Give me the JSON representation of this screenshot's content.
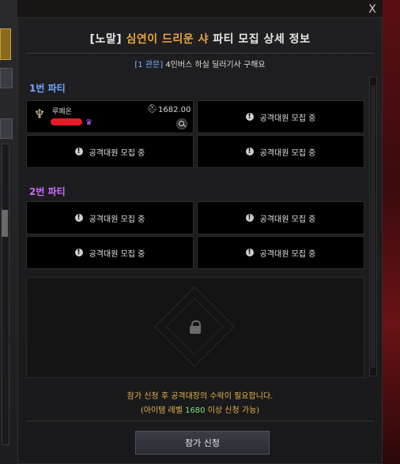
{
  "window": {
    "close_label": "X"
  },
  "header": {
    "prefix": "[노말]",
    "raid_name": "심연이 드리운 샤",
    "suffix": "파티 모집 상세 정보",
    "sub_region": "[1 관문]",
    "sub_desc": "4인버스 하실 딜러기사 구해요"
  },
  "party1": {
    "label": "1번 파티",
    "leader": {
      "class_name": "루페온",
      "item_level": "1682.00"
    },
    "empty_slot_label": "공격대원 모집 중"
  },
  "party2": {
    "label": "2번 파티",
    "empty_slot_label": "공격대원 모집 중"
  },
  "footer": {
    "notice": "참가 신청 후 공격대장의 수락이 필요합니다.",
    "level_pre": "(아이템 레벨 ",
    "level_value": "1680",
    "level_post": " 이상 신청 가능)",
    "join_label": "참가 신청"
  },
  "icons": {
    "class": "bard-harp-icon",
    "item_level": "helmet-icon",
    "inspect": "magnifier-icon",
    "leader": "crown-icon",
    "locked": "lock-icon",
    "recruiting": "exclamation-icon"
  },
  "colors": {
    "raid_name": "#e9a63b",
    "party1_label": "#6fa8ff",
    "party2_label": "#d06bff",
    "notice": "#e0b24a",
    "level_value": "#7ee081"
  }
}
